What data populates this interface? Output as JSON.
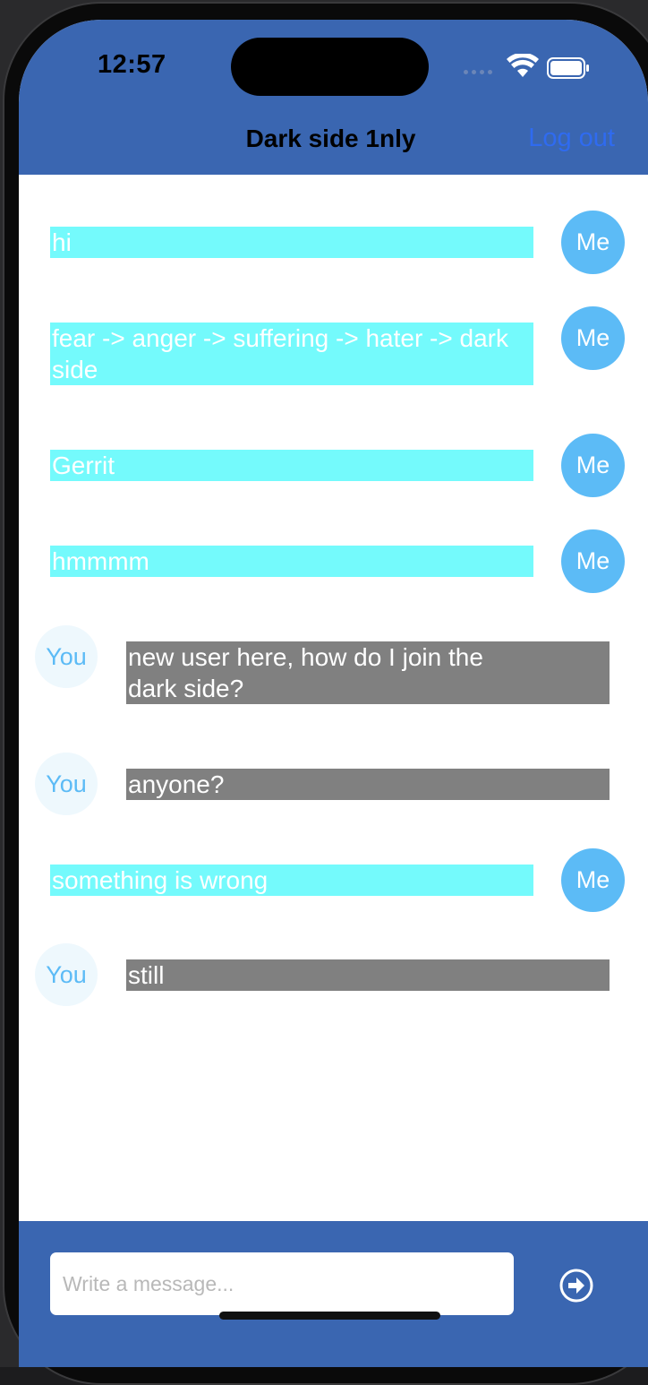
{
  "status_bar": {
    "time": "12:57"
  },
  "header": {
    "title": "Dark side 1nly",
    "logout_label": "Log out"
  },
  "messages": [
    {
      "sender": "me",
      "avatar": "Me",
      "text": "hi"
    },
    {
      "sender": "me",
      "avatar": "Me",
      "text": "fear -> anger -> suffering -> hater -> dark side"
    },
    {
      "sender": "me",
      "avatar": "Me",
      "text": "Gerrit"
    },
    {
      "sender": "me",
      "avatar": "Me",
      "text": "hmmmm"
    },
    {
      "sender": "you",
      "avatar": "You",
      "text": "new user here, how do I join the dark side?"
    },
    {
      "sender": "you",
      "avatar": "You",
      "text": "anyone?"
    },
    {
      "sender": "me",
      "avatar": "Me",
      "text": "something is wrong"
    },
    {
      "sender": "you",
      "avatar": "You",
      "text": "still"
    }
  ],
  "composer": {
    "placeholder": "Write a message...",
    "value": ""
  },
  "colors": {
    "bar": "#3a66b1",
    "my_bubble": "#74fafc",
    "their_bubble": "#808080",
    "my_avatar": "#5cbbf6",
    "their_avatar": "#eef8fd",
    "link": "#2f6bf0"
  },
  "icons": {
    "send": "arrow-circle-right-icon",
    "wifi": "wifi-icon",
    "battery": "battery-icon"
  }
}
